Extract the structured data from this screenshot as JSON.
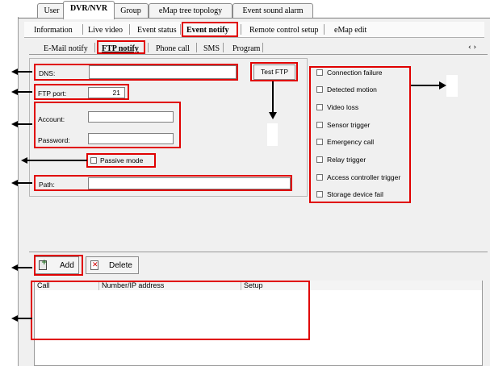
{
  "top_tabs": [
    "User",
    "DVR/NVR",
    "Group",
    "eMap tree topology",
    "Event sound alarm"
  ],
  "subnav": [
    "Information",
    "Live video",
    "Event status",
    "Event notify",
    "Remote control setup",
    "eMap edit"
  ],
  "notify_tabs": [
    "E-Mail notify",
    "FTP notify",
    "Phone call",
    "SMS",
    "Program"
  ],
  "scroll_arrows": "‹ ›",
  "form": {
    "dns_label": "DNS:",
    "dns_value": "",
    "ftp_port_label": "FTP port:",
    "ftp_port_value": "21",
    "account_label": "Account:",
    "password_label": "Password:",
    "passive_mode_label": "Passive mode",
    "path_label": "Path:",
    "test_ftp_label": "Test FTP"
  },
  "events": [
    "Connection failure",
    "Detected motion",
    "Video loss",
    "Sensor trigger",
    "Emergency call",
    "Relay trigger",
    "Access controller trigger",
    "Storage device fail"
  ],
  "toolbar": {
    "add_label": "Add",
    "delete_label": "Delete"
  },
  "table": {
    "columns": [
      "Call",
      "Number/IP address",
      "Setup"
    ]
  },
  "colors": {
    "highlight": "#e00000",
    "panel": "#f0f0f0"
  }
}
